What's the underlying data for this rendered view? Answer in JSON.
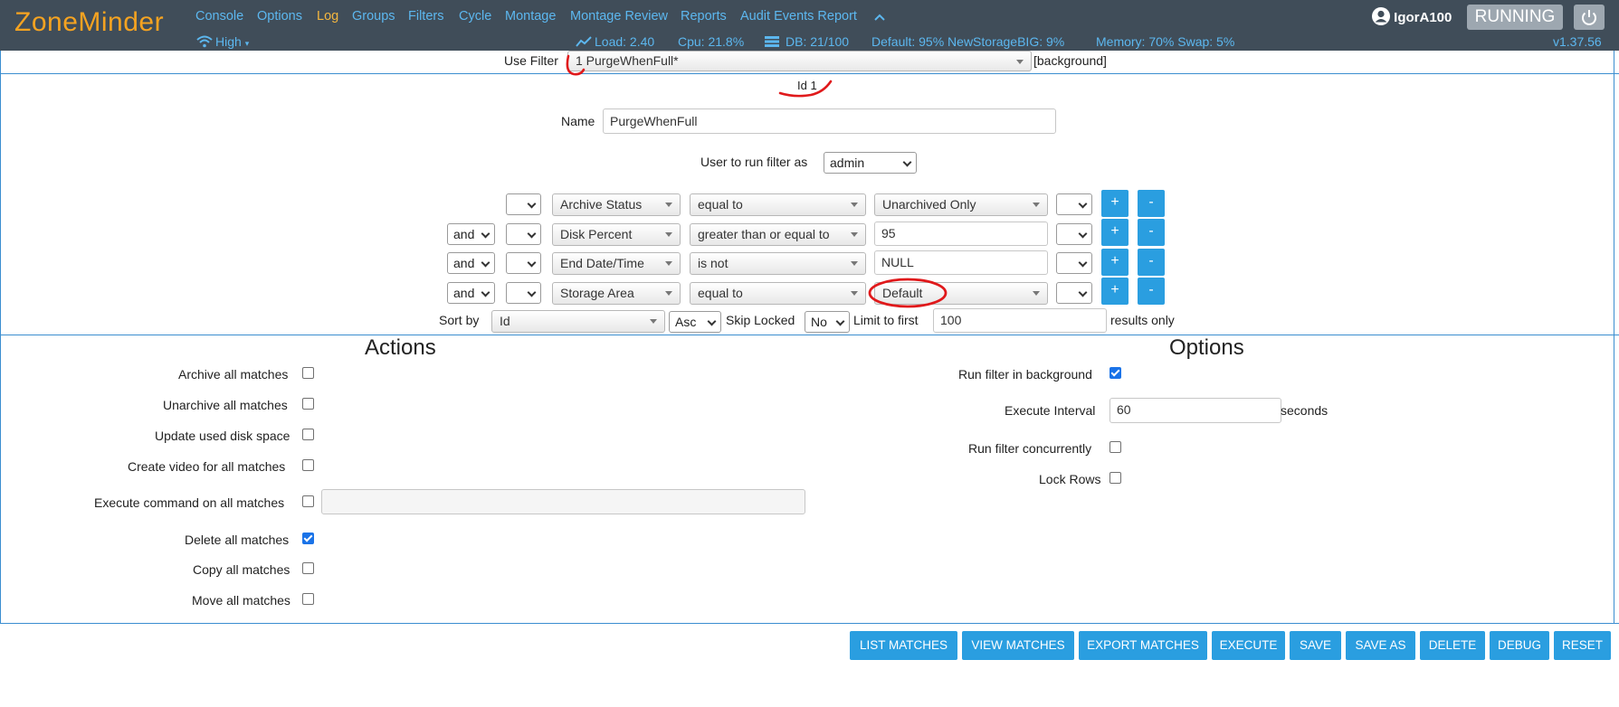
{
  "brand": "ZoneMinder",
  "nav": [
    "Console",
    "Options",
    "Log",
    "Groups",
    "Filters",
    "Cycle",
    "Montage",
    "Montage Review",
    "Reports",
    "Audit Events Report"
  ],
  "nav_bandwidth": "High",
  "stats": {
    "load": "Load: 2.40",
    "cpu": "Cpu: 21.8%",
    "db": "DB: 21/100",
    "storage": "Default: 95% NewStorageBIG: 9%",
    "memory": "Memory: 70% Swap: 5%"
  },
  "user": "IgorA100",
  "status": "RUNNING",
  "version": "v1.37.56",
  "filter": {
    "use_filter_label": "Use Filter",
    "use_filter_value": "1 PurgeWhenFull*",
    "background_tag": "[background]",
    "id_label": "Id 1",
    "name_label": "Name",
    "name_value": "PurgeWhenFull",
    "run_as_label": "User to run filter as",
    "run_as_value": "admin"
  },
  "terms": [
    {
      "conj": "",
      "attr": "Archive Status",
      "op": "equal to",
      "val": "Unarchived Only"
    },
    {
      "conj": "and",
      "attr": "Disk Percent",
      "op": "greater than or equal to",
      "val": "95"
    },
    {
      "conj": "and",
      "attr": "End Date/Time",
      "op": "is not",
      "val": "NULL"
    },
    {
      "conj": "and",
      "attr": "Storage Area",
      "op": "equal to",
      "val": "Default"
    }
  ],
  "sort": {
    "sort_by_label": "Sort by",
    "sort_field": "Id",
    "sort_dir": "Asc",
    "skip_locked_label": "Skip Locked",
    "skip_locked_value": "No",
    "limit_label": "Limit to first",
    "limit_value": "100",
    "results_only": "results only"
  },
  "actions": {
    "title": "Actions",
    "archive": "Archive all matches",
    "unarchive": "Unarchive all matches",
    "update_disk": "Update used disk space",
    "create_video": "Create video for all matches",
    "execute_cmd": "Execute command on all matches",
    "delete": "Delete all matches",
    "copy": "Copy all matches",
    "move": "Move all matches"
  },
  "options": {
    "title": "Options",
    "run_bg": "Run filter in background",
    "exec_interval": "Execute Interval",
    "exec_interval_value": "60",
    "seconds": "seconds",
    "concurrent": "Run filter concurrently",
    "lock_rows": "Lock Rows"
  },
  "buttons": [
    "LIST MATCHES",
    "VIEW MATCHES",
    "EXPORT MATCHES",
    "EXECUTE",
    "SAVE",
    "SAVE AS",
    "DELETE",
    "DEBUG",
    "RESET"
  ]
}
